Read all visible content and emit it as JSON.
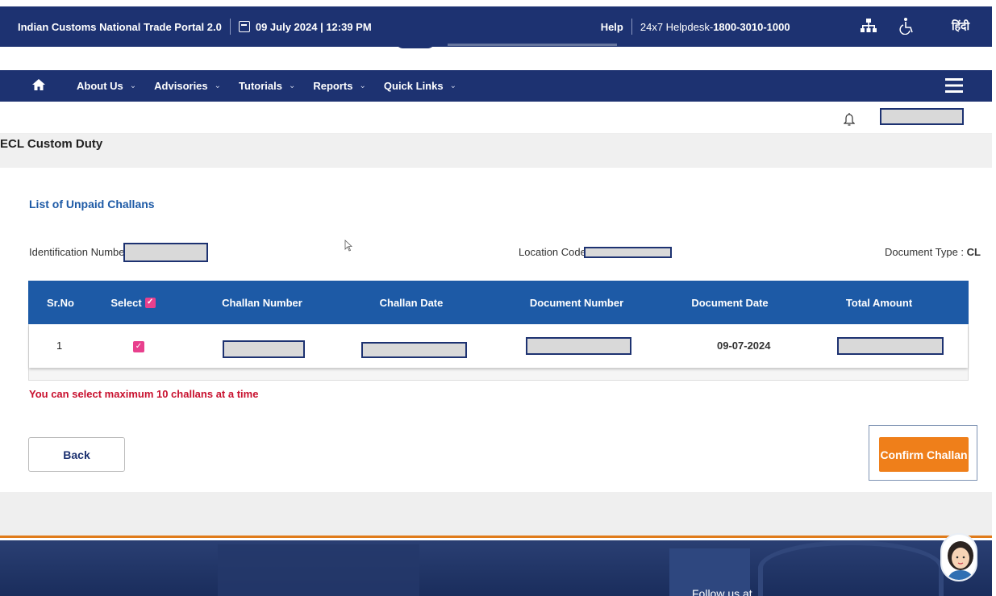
{
  "topbar": {
    "portal_name": "Indian Customs National Trade Portal 2.0",
    "datetime": "09 July 2024 | 12:39 PM",
    "help": "Help",
    "helpdesk_prefix": "24x7 Helpdesk-",
    "helpdesk_number": "1800-3010-1000",
    "hindi": "हिंदी"
  },
  "nav": {
    "items": [
      {
        "label": "About Us"
      },
      {
        "label": "Advisories"
      },
      {
        "label": "Tutorials"
      },
      {
        "label": "Reports"
      },
      {
        "label": "Quick Links"
      }
    ]
  },
  "page": {
    "title": "ECL Custom Duty",
    "section_title": "List of Unpaid Challans",
    "id_label": "Identification Number",
    "location_label": "Location Code :",
    "doctype_label": "Document Type :",
    "doctype_value": "CL",
    "warning": "You can select maximum 10 challans at a time"
  },
  "table": {
    "headers": [
      "Sr.No",
      "Select",
      "Challan Number",
      "Challan Date",
      "Document Number",
      "Document Date",
      "Total Amount"
    ],
    "rows": [
      {
        "sr_no": "1",
        "document_date": "09-07-2024"
      }
    ]
  },
  "buttons": {
    "back": "Back",
    "confirm": "Confirm Challan"
  },
  "footer": {
    "follow": "Follow us at"
  },
  "colors": {
    "navy": "#1d3271",
    "table_header": "#1d5aa6",
    "accent_orange": "#ef7f1a",
    "warning_red": "#c8102e",
    "checkbox_pink": "#e8408d"
  }
}
